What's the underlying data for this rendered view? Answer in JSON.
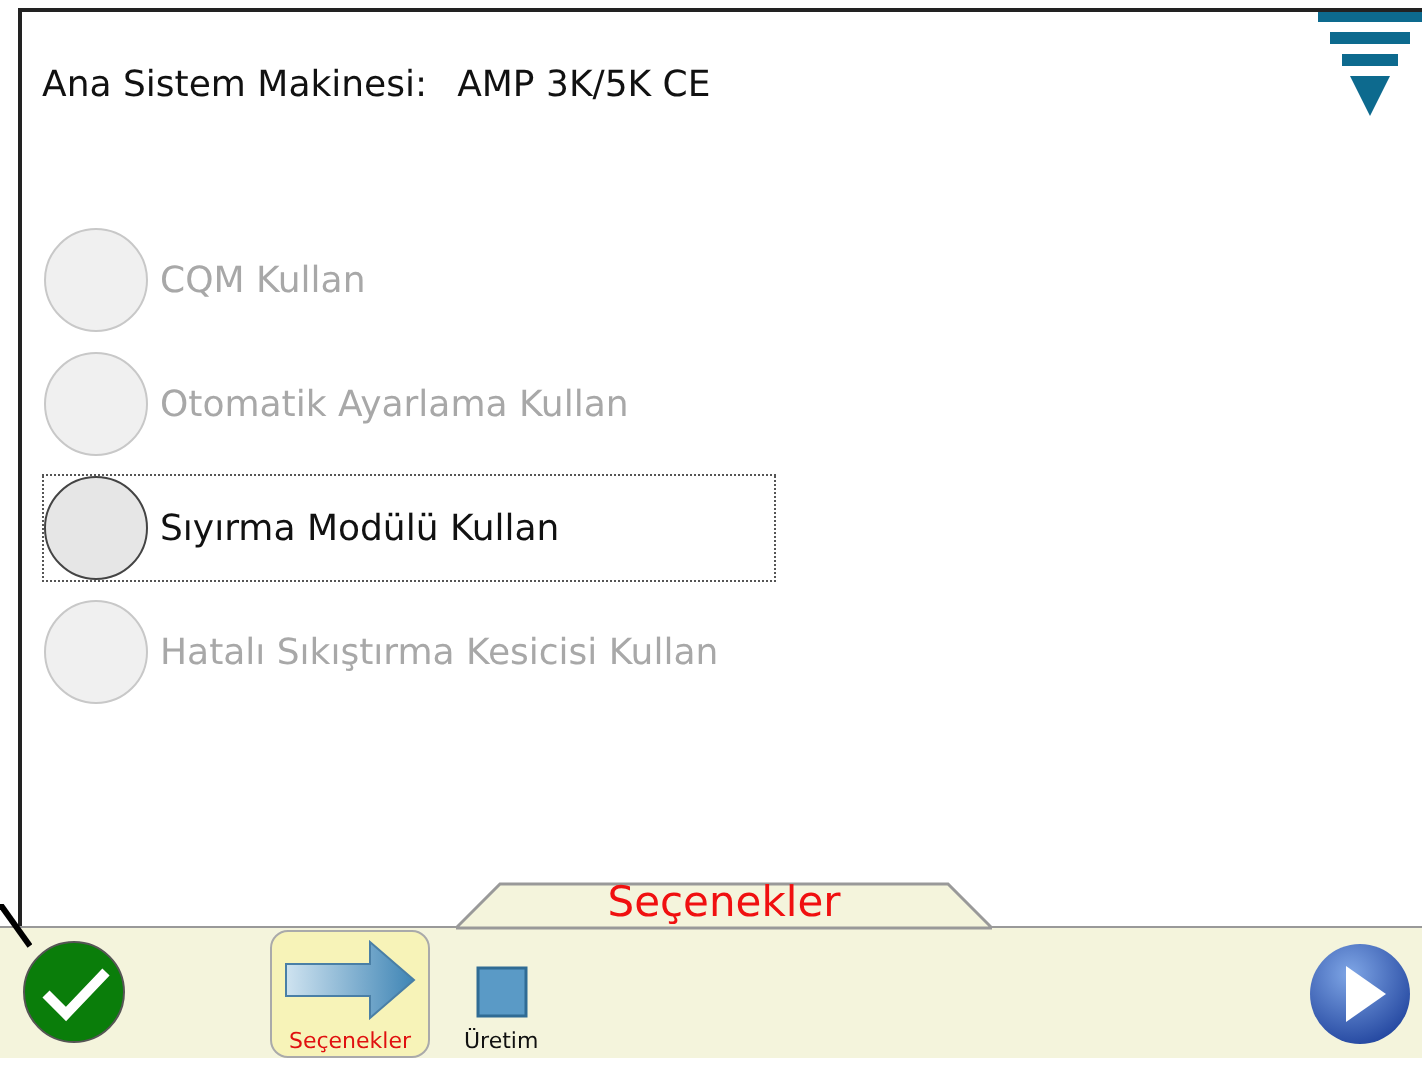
{
  "header": {
    "label": "Ana Sistem Makinesi:",
    "value": "AMP 3K/5K CE"
  },
  "options": [
    {
      "label": "CQM Kullan",
      "checked": false,
      "disabled": true,
      "focused": false
    },
    {
      "label": "Otomatik Ayarlama Kullan",
      "checked": false,
      "disabled": true,
      "focused": false
    },
    {
      "label": "Sıyırma Modülü Kullan",
      "checked": false,
      "disabled": false,
      "focused": true
    },
    {
      "label": "Hatalı Sıkıştırma Kesicisi Kullan",
      "checked": false,
      "disabled": true,
      "focused": false
    }
  ],
  "bottom_bar": {
    "tab_title": "Seçenekler",
    "nav_items": [
      {
        "kind": "arrow",
        "label": "Seçenekler",
        "selected": true
      },
      {
        "kind": "square",
        "label": "Üretim",
        "selected": false
      }
    ]
  }
}
